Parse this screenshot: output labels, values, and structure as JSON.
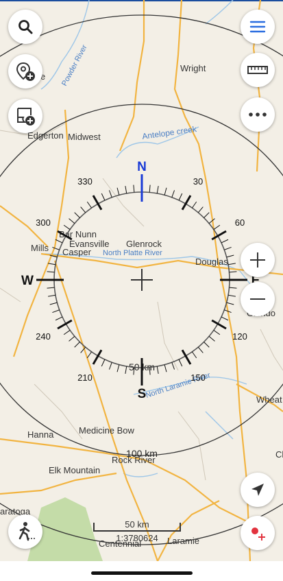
{
  "map": {
    "places": [
      {
        "id": "powder-river",
        "text": "Powder River"
      },
      {
        "id": "wright",
        "text": "Wright"
      },
      {
        "id": "edgerton",
        "text": "Edgerton"
      },
      {
        "id": "midwest",
        "text": "Midwest"
      },
      {
        "id": "antelope-creek",
        "text": "Antelope creek"
      },
      {
        "id": "bar-nunn",
        "text": "Bar Nunn"
      },
      {
        "id": "evansville",
        "text": "Evansville"
      },
      {
        "id": "mills",
        "text": "Mills"
      },
      {
        "id": "casper",
        "text": "Casper"
      },
      {
        "id": "glenrock",
        "text": "Glenrock"
      },
      {
        "id": "north-platte-river",
        "text": "North Platte River"
      },
      {
        "id": "douglas",
        "text": "Douglas"
      },
      {
        "id": "glendo",
        "text": "Glendo"
      },
      {
        "id": "north-laramie-river",
        "text": "North Laramie River"
      },
      {
        "id": "wheatland",
        "text": "Wheat"
      },
      {
        "id": "hanna",
        "text": "Hanna"
      },
      {
        "id": "medicine-bow",
        "text": "Medicine Bow"
      },
      {
        "id": "rock-river",
        "text": "Rock River"
      },
      {
        "id": "elk-mountain",
        "text": "Elk Mountain"
      },
      {
        "id": "saratoga",
        "text": "aratoga"
      },
      {
        "id": "centennial",
        "text": "Centennial"
      },
      {
        "id": "laramie",
        "text": "Laramie"
      },
      {
        "id": "ch",
        "text": "Ch"
      },
      {
        "id": "le",
        "text": "e"
      }
    ],
    "ring_labels": {
      "inner": "50 km",
      "outer": "100 km"
    }
  },
  "compass": {
    "cardinals": {
      "N": "N",
      "E": "E",
      "S": "S",
      "W": "W"
    },
    "degrees": [
      "30",
      "60",
      "120",
      "150",
      "210",
      "240",
      "300",
      "330"
    ],
    "colors": {
      "north": "#1a3bd6",
      "ink": "#111111"
    }
  },
  "scale_bar": {
    "distance": "50 km",
    "ratio": "1:3780624"
  },
  "buttons": {
    "search": "search-icon",
    "add_poi": "add-poi-icon",
    "add_note": "add-note-icon",
    "menu": "menu-icon",
    "ruler": "ruler-icon",
    "more": "more-icon",
    "zoom_in": "plus-icon",
    "zoom_out": "minus-icon",
    "my_location": "navigation-arrow-icon",
    "route": "route-icon",
    "track": "hiker-icon"
  },
  "colors": {
    "accent": "#2a6de0",
    "road": "#f2b441",
    "water": "#9dc6e8",
    "forest": "#c4dca8"
  }
}
